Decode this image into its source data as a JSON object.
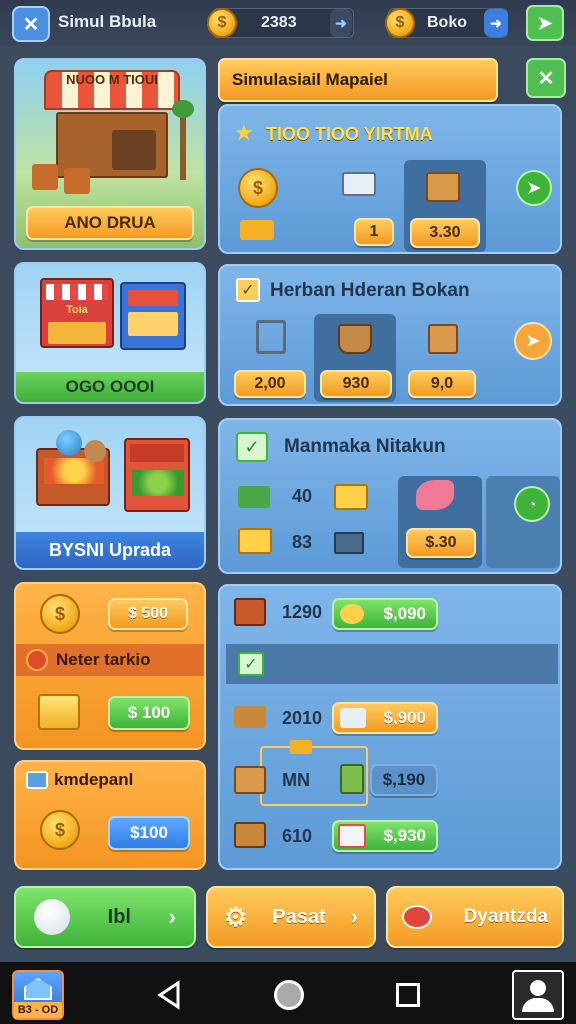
{
  "header": {
    "app_title": "Simul Bbula",
    "coins_value": "2383",
    "coins_symbol": "$",
    "gems_value": "Boko",
    "gems_symbol": "$"
  },
  "left_cards": [
    {
      "title": "NUOO M TIOUI",
      "button": "ANO DRUA"
    },
    {
      "stall_sign": "Toia",
      "banner": "OGO OOOI"
    },
    {
      "banner": "BYSNI Uprada"
    },
    {
      "price_top": "$ 500",
      "label": "Neter tarkio",
      "price_bottom": "$ 100"
    },
    {
      "label": "kmdepanl",
      "price": "$100"
    }
  ],
  "panel1": {
    "header": "Simulasiail Mapaiel",
    "subtitle": "TIOO TIOO YIRTMA",
    "qty": "1",
    "price": "3.30"
  },
  "panel2": {
    "header": "Herban Hderan Bokan",
    "prices": [
      "2,00",
      "930",
      "9,0"
    ]
  },
  "panel3": {
    "header": "Manmaka Nitakun",
    "val1": "40",
    "val2": "83",
    "price": "$.30"
  },
  "panel4": {
    "rows": [
      {
        "label": "1290",
        "price": "$,090"
      },
      {
        "label": "2010",
        "price": "$,900"
      },
      {
        "label": "MN",
        "price": "$,190"
      },
      {
        "label": "610",
        "price": "$,930"
      }
    ]
  },
  "bottom_buttons": {
    "left": "Ibl",
    "middle": "Pasat",
    "right": "Dyantzda"
  },
  "navbar": {
    "app_badge": "B3 - OD"
  }
}
